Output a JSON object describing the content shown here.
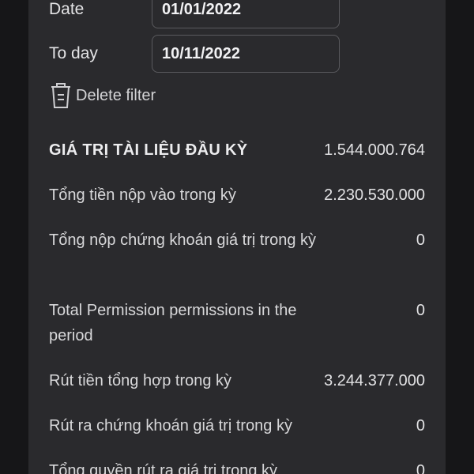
{
  "filters": {
    "from_label": "Date",
    "from_value": "01/01/2022",
    "to_label": "To day",
    "to_value": "10/11/2022",
    "delete_label": "Delete filter"
  },
  "summary": [
    {
      "label": "GIÁ TRỊ TÀI LIỆU ĐẦU KỲ",
      "value": "1.544.000.764"
    },
    {
      "label": "Tổng tiền nộp vào trong kỳ",
      "value": "2.230.530.000"
    },
    {
      "label": "Tổng nộp chứng khoán giá trị trong kỳ",
      "value": "0"
    },
    {
      "label": "Total Permission permissions in the period",
      "value": "0"
    },
    {
      "label": "Rút tiền tổng hợp trong kỳ",
      "value": "3.244.377.000"
    },
    {
      "label": "Rút ra chứng khoán giá trị trong kỳ",
      "value": "0"
    },
    {
      "label": "Tổng quyền rút ra giá trị trong kỳ",
      "value": "0"
    }
  ],
  "icons": {
    "delete": "trash-icon"
  }
}
